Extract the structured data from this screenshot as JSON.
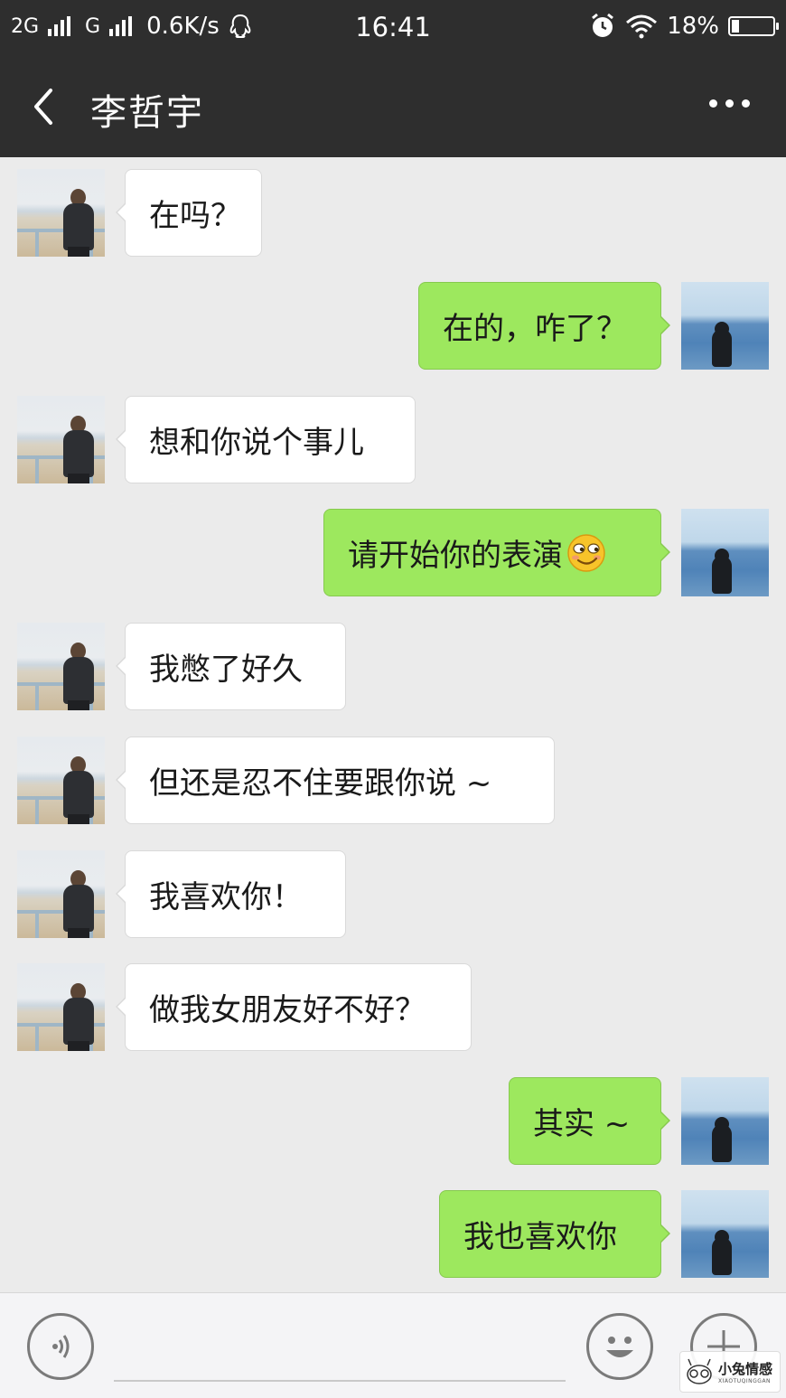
{
  "status_bar": {
    "network_1": "2G",
    "network_2": "G",
    "speed": "0.6K/s",
    "time": "16:41",
    "battery": "18%",
    "battery_level": 0.18,
    "icons": [
      "signal-icon",
      "qq-icon",
      "alarm-icon",
      "wifi-icon",
      "battery-icon"
    ]
  },
  "header": {
    "title": "李哲宇",
    "back_icon": "chevron-left-icon",
    "more_icon": "more-dots-icon"
  },
  "messages": [
    {
      "side": "left",
      "text": "在吗？"
    },
    {
      "side": "right",
      "text": "在的，咋了？"
    },
    {
      "side": "left",
      "text": "想和你说个事儿"
    },
    {
      "side": "right",
      "text": "请开始你的表演",
      "emoji": "smirk-emoji"
    },
    {
      "side": "left",
      "text": "我憋了好久"
    },
    {
      "side": "left",
      "text": "但还是忍不住要跟你说 ~"
    },
    {
      "side": "left",
      "text": "我喜欢你！"
    },
    {
      "side": "left",
      "text": "做我女朋友好不好？"
    },
    {
      "side": "right",
      "text": "其实 ~"
    },
    {
      "side": "right",
      "text": "我也喜欢你"
    }
  ],
  "input_bar": {
    "voice_icon": "voice-icon",
    "emoji_icon": "emoji-icon",
    "plus_icon": "plus-icon"
  },
  "watermark": {
    "text": "小兔情感",
    "sub": "XIAOTUQINGGAN"
  },
  "colors": {
    "header_bg": "#2e2e2e",
    "chat_bg": "#ebebeb",
    "bubble_right": "#9de85e",
    "bubble_left": "#ffffff"
  }
}
